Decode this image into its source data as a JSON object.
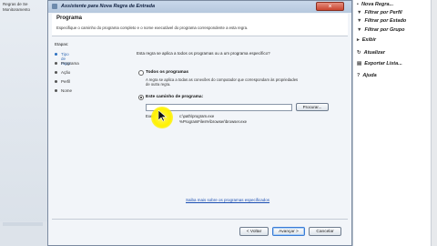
{
  "background_left": {
    "rows": [
      "Regras de Se",
      "Monitoramento"
    ]
  },
  "background_right": {
    "rows": [
      "Nova Regra...",
      "Filtrar por Perfil",
      "Filtrar por Estado",
      "Filtrar por Grupo",
      "Exibir",
      "Atualizar",
      "Exportar Lista...",
      "Ajuda"
    ]
  },
  "dialog": {
    "title": "Assistente para Nova Regra de Entrada",
    "close_icon": "×",
    "header_title": "Programa",
    "header_subtitle": "Especifique o caminho do programa completo e o nome executável do programa correspondente a esta regra.",
    "steps_title": "Etapas:",
    "steps": [
      {
        "label": "Tipo de regra",
        "active": true
      },
      {
        "label": "Programa",
        "active": true
      },
      {
        "label": "Ação",
        "active": false
      },
      {
        "label": "Perfil",
        "active": false
      },
      {
        "label": "Nome",
        "active": false
      }
    ],
    "question": "Esta regra se aplica a todos os programas ou a um programa específico?",
    "option_all": {
      "label": "Todos os programas",
      "desc": "A regra se aplica a todas as conexões do computador que correspondam às propriedades de outra regra.",
      "selected": false
    },
    "option_path": {
      "label": "Este caminho de programa:",
      "selected": true
    },
    "path_value": "",
    "browse_label": "Procurar...",
    "example_label": "Exemplo:",
    "example_lines": [
      "c:\\path\\program.exe",
      "%ProgramFiles%\\browser\\browser.exe"
    ],
    "link_text": "Saiba mais sobre os programas especificados",
    "buttons": {
      "back": "< Voltar",
      "next": "Avançar >",
      "cancel": "Cancelar"
    }
  }
}
